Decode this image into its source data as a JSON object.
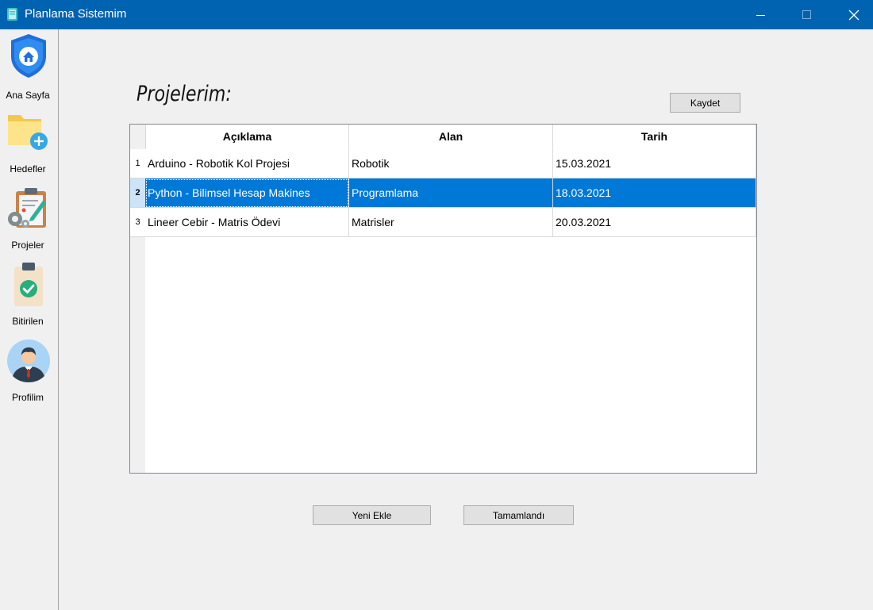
{
  "window": {
    "title": "Planlama Sistemim",
    "brand_color": "#0063b1"
  },
  "sidebar": {
    "items": [
      {
        "label": "Ana Sayfa",
        "icon": "home-shield-icon"
      },
      {
        "label": "Hedefler",
        "icon": "folder-add-icon"
      },
      {
        "label": "Projeler",
        "icon": "clipboard-settings-icon"
      },
      {
        "label": "Bitirilen",
        "icon": "clipboard-check-icon"
      },
      {
        "label": "Profilim",
        "icon": "user-avatar-icon"
      }
    ]
  },
  "main": {
    "title": "Projelerim:",
    "save_label": "Kaydet",
    "add_label": "Yeni Ekle",
    "done_label": "Tamamlandı"
  },
  "table": {
    "columns": [
      "Açıklama",
      "Alan",
      "Tarih"
    ],
    "selected_row": 2,
    "selection_color": "#0078d7",
    "rows": [
      {
        "num": "1",
        "cells": [
          "Arduino - Robotik Kol Projesi",
          "Robotik",
          "15.03.2021"
        ]
      },
      {
        "num": "2",
        "cells": [
          "Python - Bilimsel Hesap Makines",
          "Programlama",
          "18.03.2021"
        ]
      },
      {
        "num": "3",
        "cells": [
          "Lineer Cebir - Matris Ödevi",
          "Matrisler",
          "20.03.2021"
        ]
      }
    ]
  }
}
